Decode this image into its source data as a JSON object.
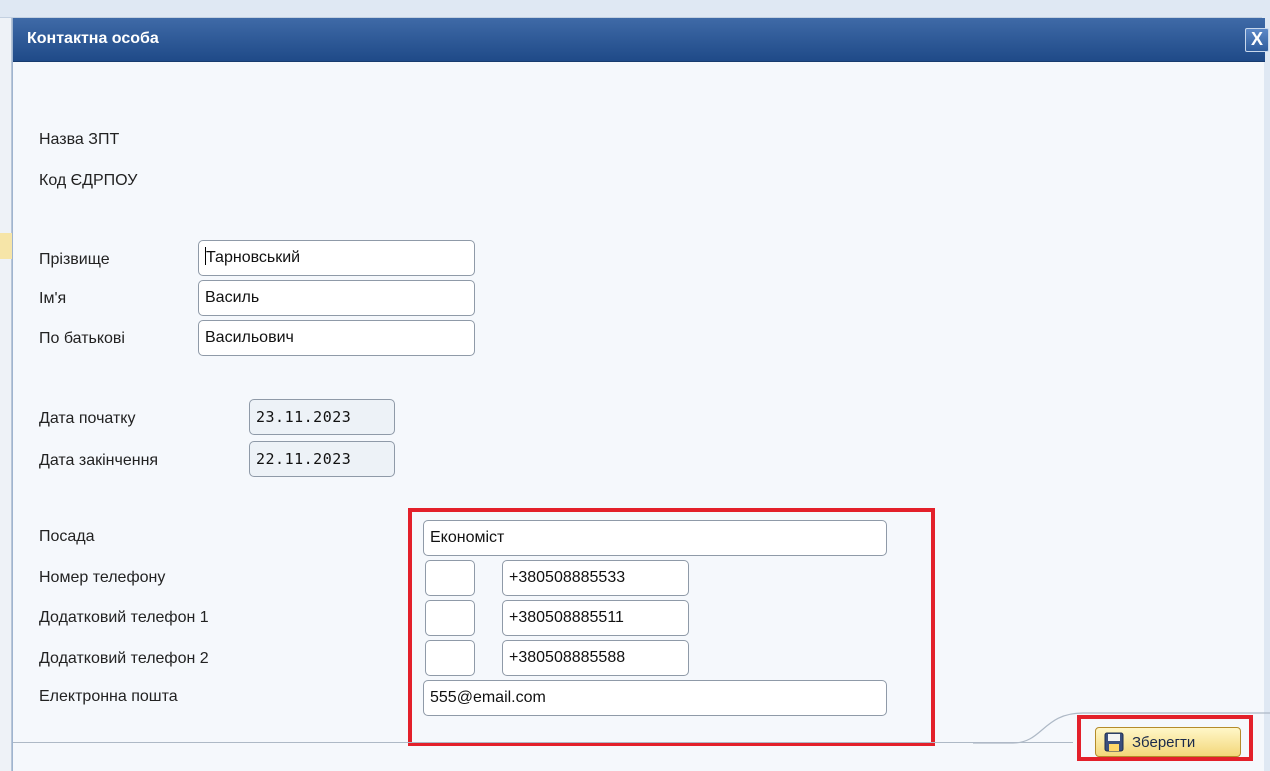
{
  "dialog": {
    "title": "Контактна особа",
    "close_label": "X"
  },
  "info": {
    "org_name_label": "Назва ЗПТ",
    "edrpou_label": "Код ЄДРПОУ"
  },
  "person": {
    "surname_label": "Прізвище",
    "surname_value": "Тарновський",
    "name_label": "Ім'я",
    "name_value": "Василь",
    "patronymic_label": "По батькові",
    "patronymic_value": "Васильович"
  },
  "dates": {
    "start_label": "Дата початку",
    "start_value": "23.11.2023",
    "end_label": "Дата закінчення",
    "end_value": "22.11.2023"
  },
  "contacts": {
    "position_label": "Посада",
    "position_value": "Економіст",
    "phone_label": "Номер телефону",
    "phone_code": "",
    "phone_value": "+380508885533",
    "phone1_label": "Додатковий телефон 1",
    "phone1_code": "",
    "phone1_value": "+380508885511",
    "phone2_label": "Додатковий телефон 2",
    "phone2_code": "",
    "phone2_value": "+380508885588",
    "email_label": "Електронна пошта",
    "email_value": "555@email.com"
  },
  "footer": {
    "save_label": "Зберегти"
  },
  "colors": {
    "titlebar": "#2a5592",
    "highlight": "#e3202a",
    "save_button": "#f7e39a"
  }
}
